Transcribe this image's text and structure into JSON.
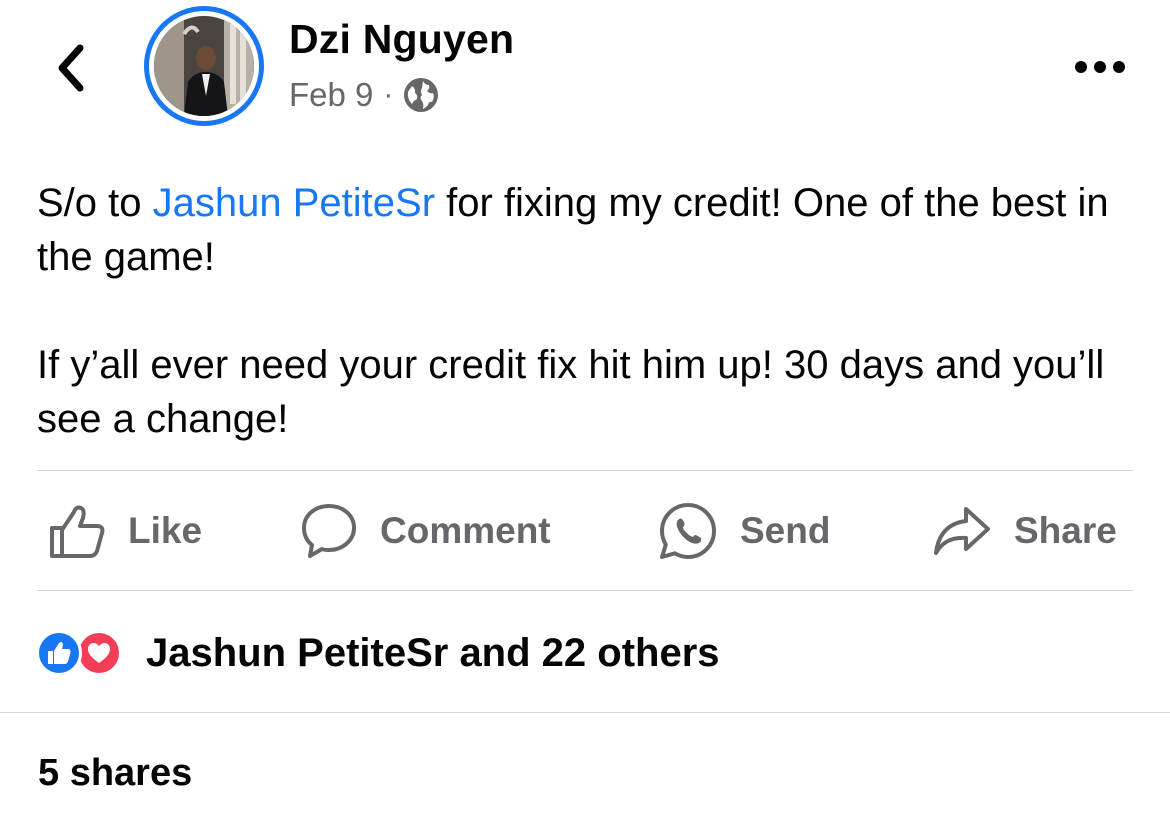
{
  "header": {
    "author_name": "Dzi Nguyen",
    "date": "Feb 9",
    "separator": "·",
    "privacy_icon": "globe-icon",
    "back_icon": "chevron-left-icon",
    "more_icon": "more-horizontal-icon"
  },
  "post": {
    "line1_prefix": "S/o to ",
    "mention": "Jashun PetiteSr",
    "line1_suffix": " for fixing my credit! One of the best in the game!",
    "paragraph2": "If y’all ever need your credit fix hit him up! 30 days and you’ll see a change!"
  },
  "actions": {
    "like": "Like",
    "comment": "Comment",
    "send": "Send",
    "share": "Share"
  },
  "reactions": {
    "summary": "Jashun PetiteSr and 22 others",
    "types": [
      "like",
      "love"
    ]
  },
  "shares": {
    "label": "5 shares"
  },
  "colors": {
    "accent": "#1877f2",
    "love": "#f33e58",
    "secondary_text": "#65676b",
    "divider": "#d7d9dd"
  }
}
